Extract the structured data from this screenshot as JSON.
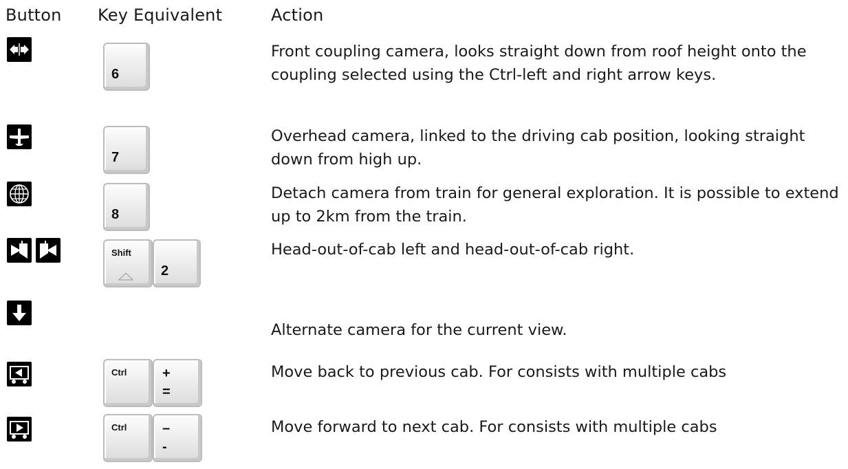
{
  "headers": {
    "button": "Button",
    "key": "Key Equivalent",
    "action": "Action"
  },
  "rows": [
    {
      "icon": "front-coupling-camera-icon",
      "key": {
        "main": "6"
      },
      "action": "Front coupling camera, looks straight down from roof height onto the coupling selected using the Ctrl-left and right arrow keys."
    },
    {
      "icon": "overhead-camera-icon",
      "key": {
        "main": "7"
      },
      "action": "Overhead camera, linked to the driving cab position, looking straight down from high up."
    },
    {
      "icon": "free-camera-globe-icon",
      "key": {
        "main": "8"
      },
      "action": "Detach camera from train for general exploration. It is possible to extend up to 2km from the train."
    },
    {
      "icons": [
        "head-out-left-icon",
        "head-out-right-icon"
      ],
      "key": {
        "modifier": "Shift",
        "main": "2"
      },
      "action": "Head-out-of-cab left and head-out-of-cab right."
    },
    {
      "icon": "alternate-camera-down-arrow-icon",
      "action": "Alternate camera for the current view."
    },
    {
      "icon": "previous-cab-icon",
      "key": {
        "modifier": "Ctrl",
        "top": "+",
        "bottom": "="
      },
      "action": "Move back to previous cab. For consists with multiple cabs"
    },
    {
      "icon": "next-cab-icon",
      "key": {
        "modifier": "Ctrl",
        "top": "–",
        "bottom": "-"
      },
      "action": "Move forward to next cab. For consists with multiple cabs"
    }
  ]
}
